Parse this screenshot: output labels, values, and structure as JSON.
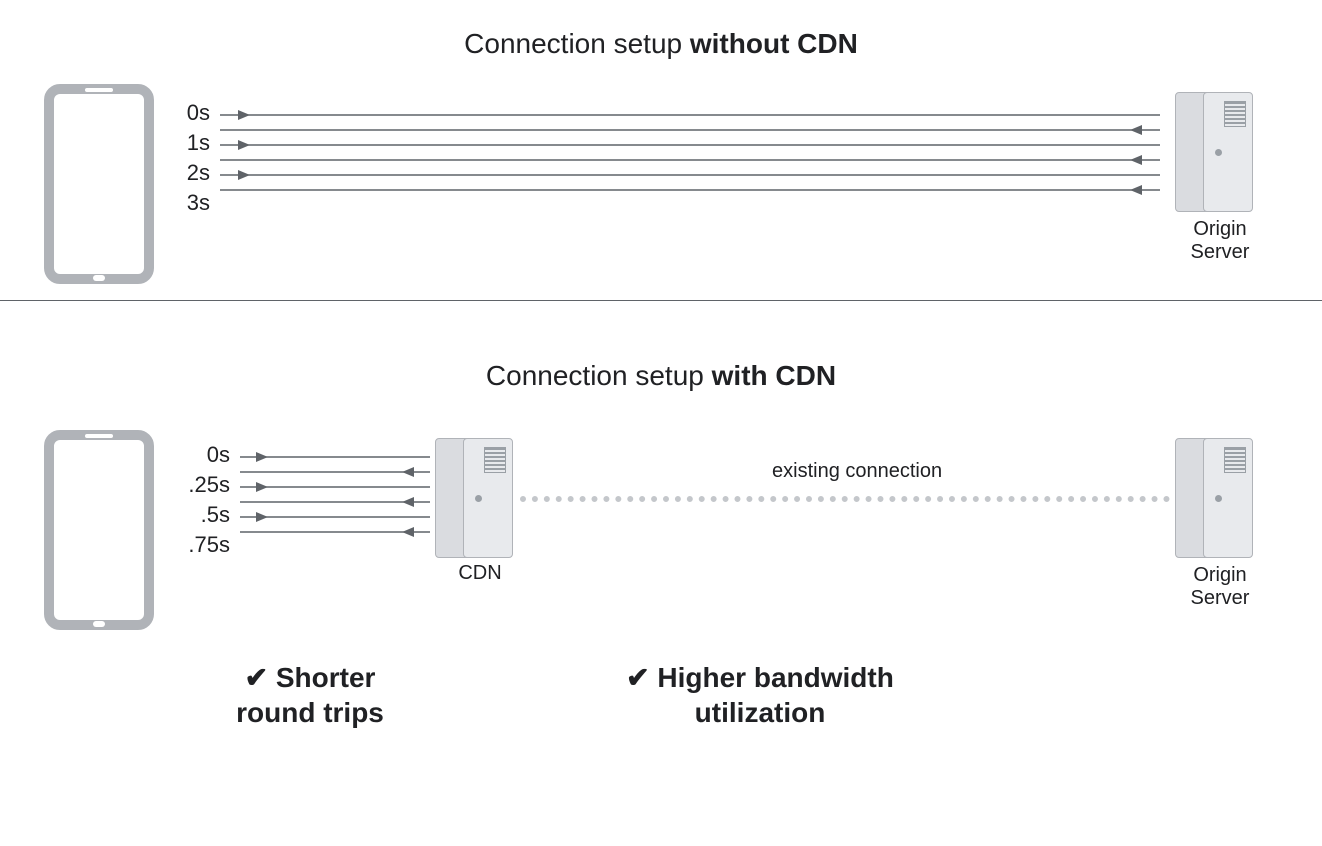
{
  "top": {
    "title_prefix": "Connection setup ",
    "title_bold": "without CDN",
    "labels": {
      "t0": "0s",
      "t1": "1s",
      "t2": "2s",
      "t3": "3s"
    },
    "server_label_l1": "Origin",
    "server_label_l2": "Server"
  },
  "bottom": {
    "title_prefix": "Connection setup ",
    "title_bold": "with CDN",
    "labels": {
      "t0": "0s",
      "t1": ".25s",
      "t2": ".5s",
      "t3": ".75s"
    },
    "cdn_label": "CDN",
    "existing": "existing connection",
    "server_label_l1": "Origin",
    "server_label_l2": "Server",
    "benefit1_l1": "✔ Shorter",
    "benefit1_l2": "round trips",
    "benefit2_l1": "✔ Higher bandwidth",
    "benefit2_l2": "utilization"
  }
}
